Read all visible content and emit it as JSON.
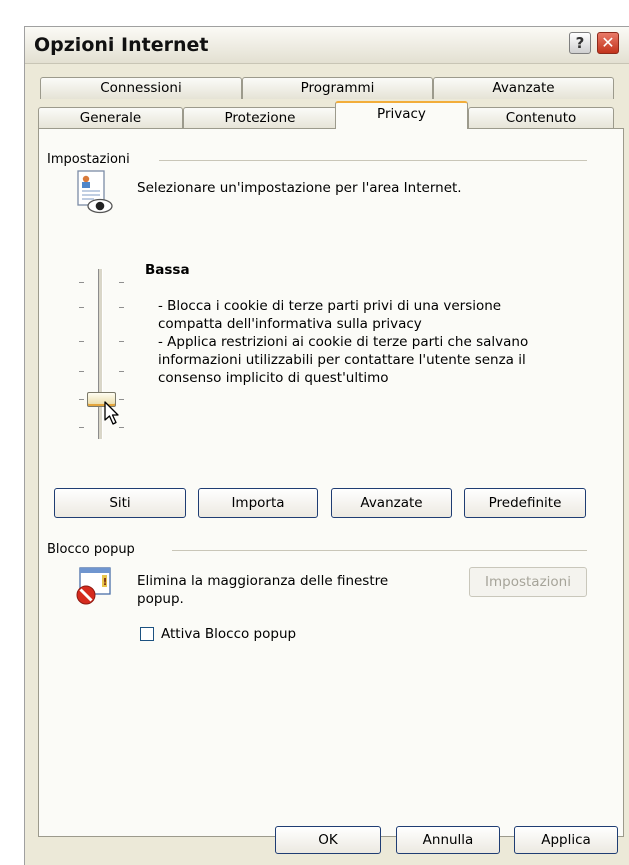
{
  "window": {
    "title": "Opzioni Internet"
  },
  "title_buttons": {
    "help": "?",
    "close": "✕"
  },
  "tabs_row1": [
    "Connessioni",
    "Programmi",
    "Avanzate"
  ],
  "tabs_row2": [
    "Generale",
    "Protezione",
    "Privacy",
    "Contenuto"
  ],
  "active_tab": "Privacy",
  "settings": {
    "section_label": "Impostazioni",
    "intro": "Selezionare un'impostazione per l'area Internet.",
    "level_title": "Bassa",
    "description": "- Blocca i cookie di terze parti privi di una versione compatta dell'informativa sulla privacy\n- Applica restrizioni ai cookie di terze parti che salvano informazioni utilizzabili per contattare l'utente senza il consenso implicito di quest'ultimo",
    "slider_level": 1,
    "slider_levels": 6,
    "buttons": {
      "sites": "Siti",
      "import": "Importa",
      "advanced": "Avanzate",
      "defaults": "Predefinite"
    }
  },
  "popup": {
    "section_label": "Blocco popup",
    "description": "Elimina la maggioranza delle finestre popup.",
    "settings_button": "Impostazioni",
    "checkbox_label": "Attiva Blocco popup",
    "checkbox_checked": false
  },
  "footer": {
    "ok": "OK",
    "cancel": "Annulla",
    "apply": "Applica"
  }
}
